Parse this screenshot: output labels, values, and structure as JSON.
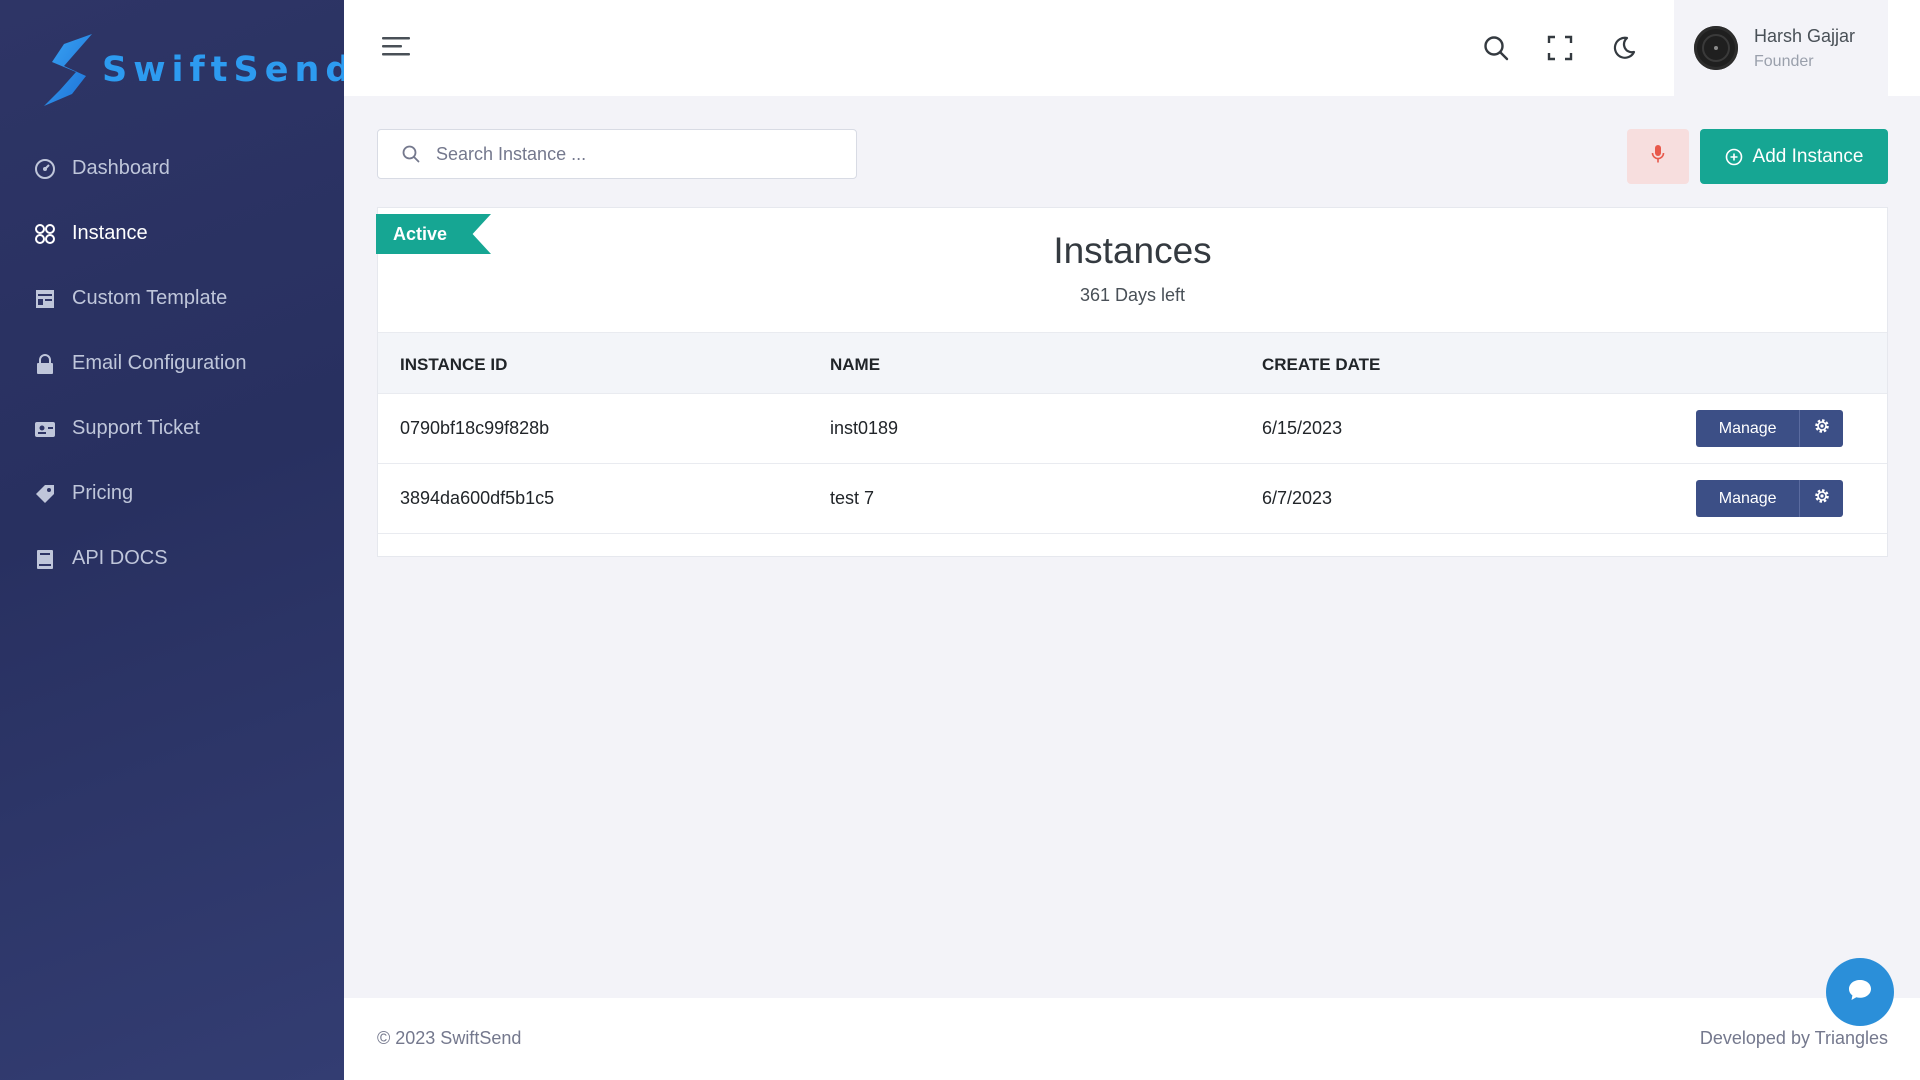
{
  "brand": {
    "name": "SwiftSend",
    "color": "#2d9bf0"
  },
  "sidebar": {
    "items": [
      {
        "label": "Dashboard",
        "icon": "gauge-icon",
        "active": false
      },
      {
        "label": "Instance",
        "icon": "grid-icon",
        "active": true
      },
      {
        "label": "Custom Template",
        "icon": "template-icon",
        "active": false
      },
      {
        "label": "Email Configuration",
        "icon": "lock-icon",
        "active": false
      },
      {
        "label": "Support Ticket",
        "icon": "ticket-icon",
        "active": false
      },
      {
        "label": "Pricing",
        "icon": "tag-icon",
        "active": false
      },
      {
        "label": "API DOCS",
        "icon": "book-icon",
        "active": false
      }
    ]
  },
  "topbar": {
    "icons": [
      "menu-icon",
      "search-icon",
      "fullscreen-icon",
      "moon-icon"
    ],
    "user": {
      "name": "Harsh Gajjar",
      "role": "Founder"
    }
  },
  "search": {
    "placeholder": "Search Instance ...",
    "value": ""
  },
  "actions": {
    "add_label": "Add Instance",
    "add_color": "#16a693",
    "mic_icon": "microphone-icon"
  },
  "card": {
    "ribbon": "Active",
    "title": "Instances",
    "subtitle": "361 Days left"
  },
  "table": {
    "headers": [
      "INSTANCE ID",
      "NAME",
      "CREATE DATE"
    ],
    "rows": [
      {
        "id": "0790bf18c99f828b",
        "name": "inst0189",
        "date": "6/15/2023",
        "action": "Manage"
      },
      {
        "id": "3894da600df5b1c5",
        "name": "test 7",
        "date": "6/7/2023",
        "action": "Manage"
      }
    ]
  },
  "footer": {
    "left": "© 2023 SwiftSend",
    "right": "Developed by Triangles"
  },
  "chat": {
    "icon": "chat-icon"
  }
}
